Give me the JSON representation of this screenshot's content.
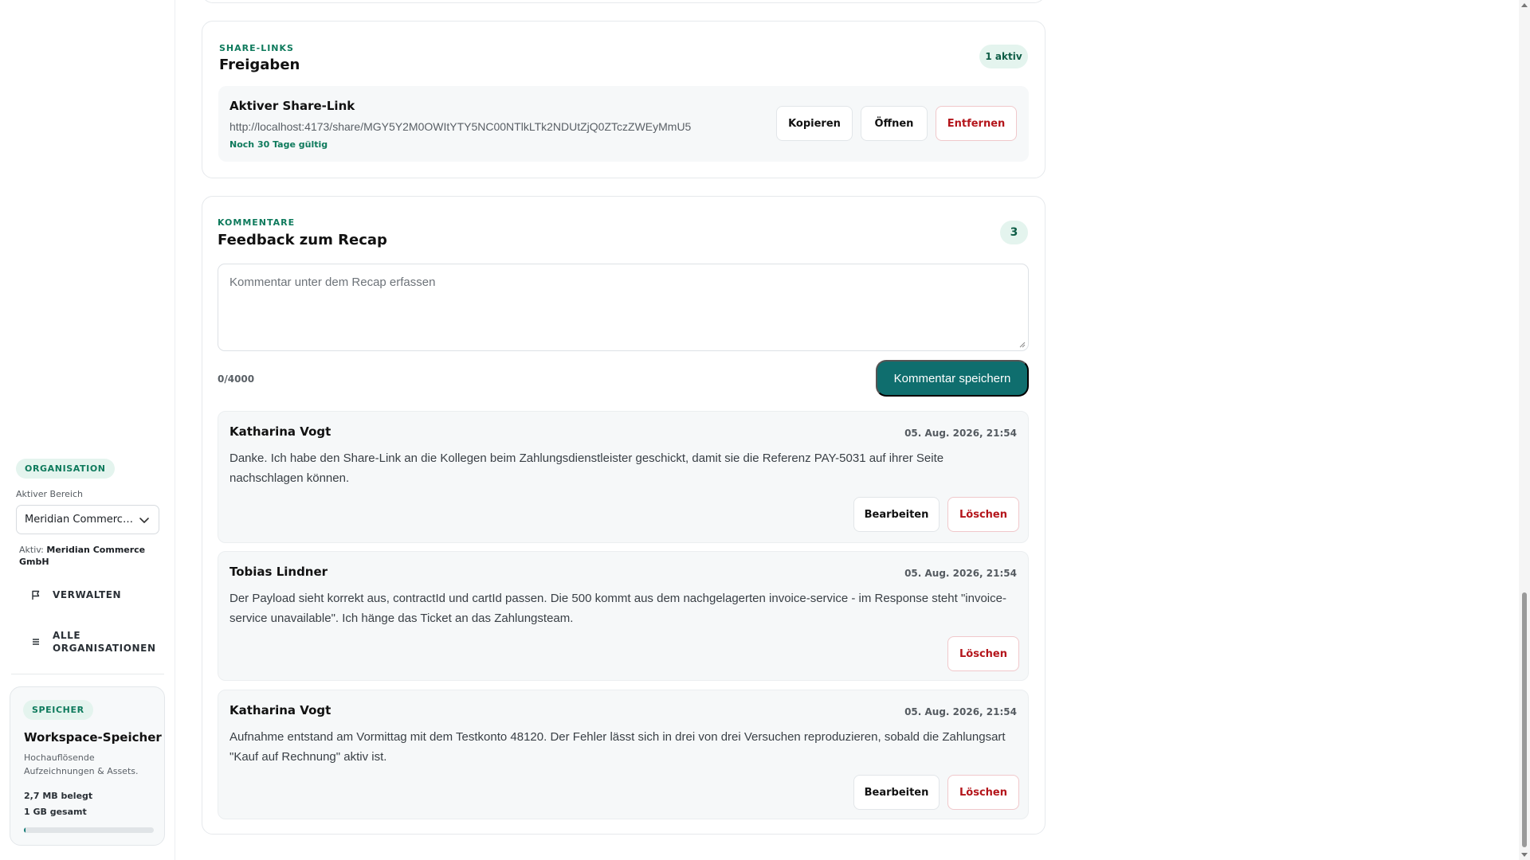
{
  "sidebar": {
    "org_badge": "ORGANISATION",
    "area_label": "Aktiver Bereich",
    "org_select_value": "Meridian Commerce...",
    "active_prefix": "Aktiv:",
    "active_org": "Meridian Commerce GmbH",
    "nav": {
      "manage": "VERWALTEN",
      "all_orgs": "ALLE ORGANISATIONEN"
    },
    "storage": {
      "badge": "SPEICHER",
      "title": "Workspace-Speicher",
      "desc": "Hochauflösende Aufzeichnungen & Assets.",
      "used": "2,7 MB belegt",
      "total": "1 GB gesamt",
      "fill_fraction": 0.0027
    }
  },
  "share": {
    "eyebrow": "SHARE-LINKS",
    "title": "Freigaben",
    "count_badge": "1 aktiv",
    "link_title": "Aktiver Share-Link",
    "url": "http://localhost:4173/share/MGY5Y2M0OWItYTY5NC00NTlkLTk2NDUtZjQ0ZTczZWEyMmU5",
    "validity": "Noch 30 Tage gültig",
    "buttons": {
      "copy": "Kopieren",
      "open": "Öffnen",
      "remove": "Entfernen"
    }
  },
  "comments": {
    "eyebrow": "KOMMENTARE",
    "title": "Feedback zum Recap",
    "count": "3",
    "placeholder": "Kommentar unter dem Recap erfassen",
    "char_count": "0/4000",
    "save_label": "Kommentar speichern",
    "edit_label": "Bearbeiten",
    "delete_label": "Löschen",
    "items": [
      {
        "author": "Katharina Vogt",
        "date": "05. Aug. 2026, 21:54",
        "text": "Danke. Ich habe den Share-Link an die Kollegen beim Zahlungsdienstleister geschickt, damit sie die Referenz PAY-5031 auf ihrer Seite nachschlagen können."
      },
      {
        "author": "Tobias Lindner",
        "date": "05. Aug. 2026, 21:54",
        "text": "Der Payload sieht korrekt aus, contractId und cartId passen. Die 500 kommt aus dem nachgelagerten invoice-service - im Response steht \"invoice-service unavailable\". Ich hänge das Ticket an das Zahlungsteam."
      },
      {
        "author": "Katharina Vogt",
        "date": "05. Aug. 2026, 21:54",
        "text": "Aufnahme entstand am Vormittag mit dem Testkonto 48120. Der Fehler lässt sich in drei von drei Versuchen reproduzieren, sobald die Zahlungsart \"Kauf auf Rechnung\" aktiv ist."
      }
    ]
  },
  "colors": {
    "accent": "#0f6e6e",
    "eyebrow_green": "#0e7a5c",
    "badge_bg": "#e4f4ee",
    "danger": "#b4151b"
  }
}
